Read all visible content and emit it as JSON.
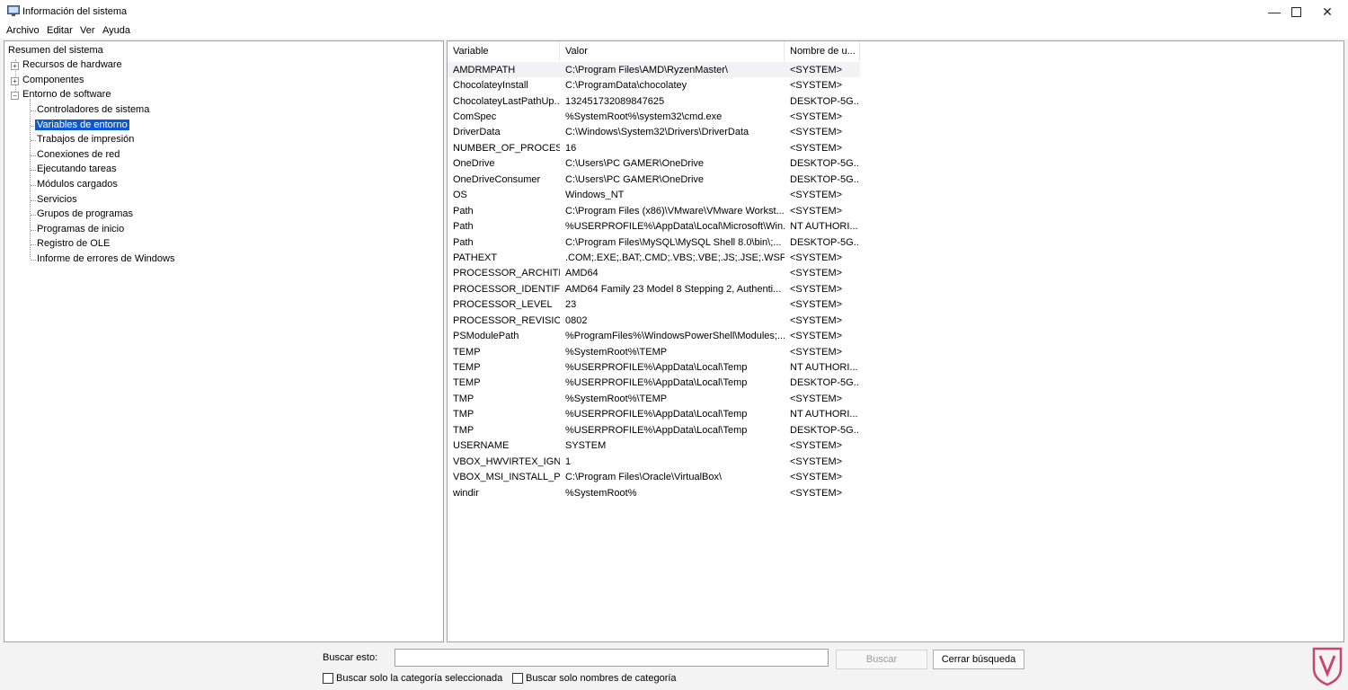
{
  "window": {
    "title": "Información del sistema"
  },
  "menu": [
    "Archivo",
    "Editar",
    "Ver",
    "Ayuda"
  ],
  "tree": {
    "root": "Resumen del sistema",
    "nodes": [
      {
        "label": "Recursos de hardware",
        "expander": "+"
      },
      {
        "label": "Componentes",
        "expander": "+"
      },
      {
        "label": "Entorno de software",
        "expander": "−"
      }
    ],
    "children": [
      "Controladores de sistema",
      "Variables de entorno",
      "Trabajos de impresión",
      "Conexiones de red",
      "Ejecutando tareas",
      "Módulos cargados",
      "Servicios",
      "Grupos de programas",
      "Programas de inicio",
      "Registro de OLE",
      "Informe de errores de Windows"
    ],
    "selected": "Variables de entorno"
  },
  "list": {
    "columns": [
      "Variable",
      "Valor",
      "Nombre de u..."
    ],
    "rows": [
      [
        "AMDRMPATH",
        "C:\\Program Files\\AMD\\RyzenMaster\\",
        "<SYSTEM>"
      ],
      [
        "ChocolateyInstall",
        "C:\\ProgramData\\chocolatey",
        "<SYSTEM>"
      ],
      [
        "ChocolateyLastPathUp...",
        "132451732089847625",
        "DESKTOP-5G..."
      ],
      [
        "ComSpec",
        "%SystemRoot%\\system32\\cmd.exe",
        "<SYSTEM>"
      ],
      [
        "DriverData",
        "C:\\Windows\\System32\\Drivers\\DriverData",
        "<SYSTEM>"
      ],
      [
        "NUMBER_OF_PROCESS...",
        "16",
        "<SYSTEM>"
      ],
      [
        "OneDrive",
        "C:\\Users\\PC GAMER\\OneDrive",
        "DESKTOP-5G..."
      ],
      [
        "OneDriveConsumer",
        "C:\\Users\\PC GAMER\\OneDrive",
        "DESKTOP-5G..."
      ],
      [
        "OS",
        "Windows_NT",
        "<SYSTEM>"
      ],
      [
        "Path",
        "C:\\Program Files (x86)\\VMware\\VMware Workst...",
        "<SYSTEM>"
      ],
      [
        "Path",
        "%USERPROFILE%\\AppData\\Local\\Microsoft\\Win...",
        "NT AUTHORI..."
      ],
      [
        "Path",
        "C:\\Program Files\\MySQL\\MySQL Shell 8.0\\bin\\;...",
        "DESKTOP-5G..."
      ],
      [
        "PATHEXT",
        ".COM;.EXE;.BAT;.CMD;.VBS;.VBE;.JS;.JSE;.WSF;.WS...",
        "<SYSTEM>"
      ],
      [
        "PROCESSOR_ARCHITE...",
        "AMD64",
        "<SYSTEM>"
      ],
      [
        "PROCESSOR_IDENTIFIER",
        "AMD64 Family 23 Model 8 Stepping 2, Authenti...",
        "<SYSTEM>"
      ],
      [
        "PROCESSOR_LEVEL",
        "23",
        "<SYSTEM>"
      ],
      [
        "PROCESSOR_REVISION",
        "0802",
        "<SYSTEM>"
      ],
      [
        "PSModulePath",
        "%ProgramFiles%\\WindowsPowerShell\\Modules;...",
        "<SYSTEM>"
      ],
      [
        "TEMP",
        "%SystemRoot%\\TEMP",
        "<SYSTEM>"
      ],
      [
        "TEMP",
        "%USERPROFILE%\\AppData\\Local\\Temp",
        "NT AUTHORI..."
      ],
      [
        "TEMP",
        "%USERPROFILE%\\AppData\\Local\\Temp",
        "DESKTOP-5G..."
      ],
      [
        "TMP",
        "%SystemRoot%\\TEMP",
        "<SYSTEM>"
      ],
      [
        "TMP",
        "%USERPROFILE%\\AppData\\Local\\Temp",
        "NT AUTHORI..."
      ],
      [
        "TMP",
        "%USERPROFILE%\\AppData\\Local\\Temp",
        "DESKTOP-5G..."
      ],
      [
        "USERNAME",
        "SYSTEM",
        "<SYSTEM>"
      ],
      [
        "VBOX_HWVIRTEX_IGN...",
        "1",
        "<SYSTEM>"
      ],
      [
        "VBOX_MSI_INSTALL_PA...",
        "C:\\Program Files\\Oracle\\VirtualBox\\",
        "<SYSTEM>"
      ],
      [
        "windir",
        "%SystemRoot%",
        "<SYSTEM>"
      ]
    ]
  },
  "search": {
    "label": "Buscar esto:",
    "value": "",
    "search_button": "Buscar",
    "close_button": "Cerrar búsqueda",
    "checkbox_selected_category": "Buscar solo la categoría seleccionada",
    "checkbox_category_names": "Buscar solo nombres de categoría"
  },
  "colors": {
    "selection": "#0a59d3",
    "watermark": "#c0245b"
  }
}
